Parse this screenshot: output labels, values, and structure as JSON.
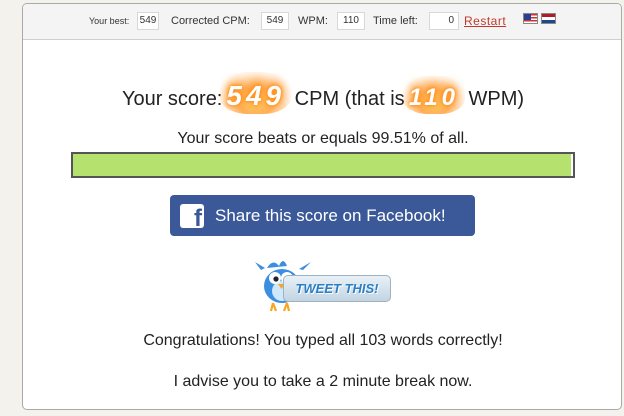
{
  "topbar": {
    "best_label": "Your best:",
    "best_value": "549",
    "corrected_cpm_label": "Corrected CPM:",
    "corrected_cpm_value": "549",
    "wpm_label": "WPM:",
    "wpm_value": "110",
    "time_left_label": "Time left:",
    "time_left_value": "0",
    "restart_label": "Restart",
    "flags": [
      "us-flag-icon",
      "netherlands-flag-icon"
    ]
  },
  "result": {
    "score_prefix": "Your score:",
    "cpm_value": "549",
    "cpm_text": "CPM (that is",
    "wpm_value": "110",
    "wpm_suffix": "WPM)",
    "beats_text": "Your score beats or equals 99.51% of all.",
    "percentile": 99.51
  },
  "share": {
    "facebook_label": "Share this score on Facebook!",
    "facebook_icon": "facebook-icon",
    "tweet_label": "TWEET THIS!",
    "tweet_icon": "twitter-bird-icon"
  },
  "messages": {
    "congrats": "Congratulations! You typed all 103 words correctly!",
    "advice": "I advise you to take a 2 minute break now."
  },
  "colors": {
    "progress_fill": "#b5e16e",
    "facebook_blue": "#3b5998",
    "restart_red": "#c0392b"
  }
}
